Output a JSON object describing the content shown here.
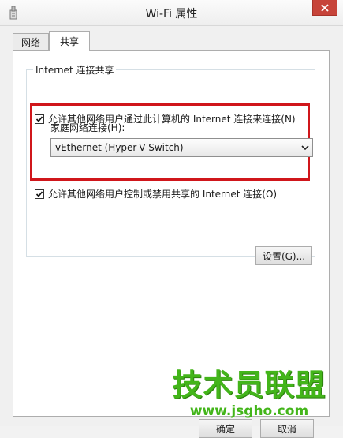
{
  "window": {
    "title": "Wi-Fi 属性",
    "close_glyph": "✕",
    "icon": "wifi-adapter-icon"
  },
  "tabs": [
    {
      "label": "网络",
      "active": false
    },
    {
      "label": "共享",
      "active": true
    }
  ],
  "sharing": {
    "group_title": "Internet 连接共享",
    "allow_share_checkbox": {
      "label": "允许其他网络用户通过此计算机的 Internet 连接来连接(N)",
      "checked": true
    },
    "home_network_label": "家庭网络连接(H):",
    "home_network_select": {
      "value": "vEthernet (Hyper-V Switch)"
    },
    "allow_control_checkbox": {
      "label": "允许其他网络用户控制或禁用共享的 Internet 连接(O)",
      "checked": true
    },
    "settings_button": "设置(G)..."
  },
  "footer": {
    "ok_button": "确定",
    "cancel_button": "取消"
  },
  "watermark": {
    "logo_text": "技术员联盟",
    "url": "www.jsgho.com"
  },
  "colors": {
    "highlight_border": "#d0161b",
    "close_button": "#c7443a",
    "watermark": "#43b51a"
  }
}
